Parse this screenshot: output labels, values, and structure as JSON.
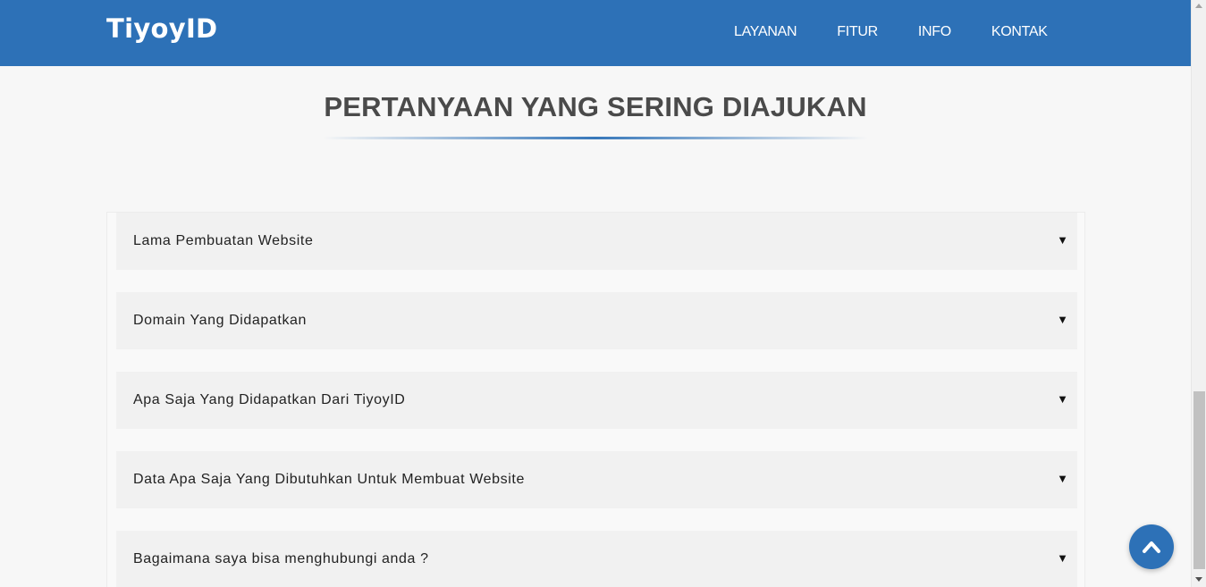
{
  "header": {
    "brand": "TiyoyID",
    "nav": [
      "LAYANAN",
      "FITUR",
      "INFO",
      "KONTAK"
    ],
    "bg_color": "#2d71b7"
  },
  "faq_section": {
    "title": "PERTANYAAN YANG SERING DIAJUKAN",
    "items": [
      {
        "question": "Lama Pembuatan Website",
        "arrow": "▼"
      },
      {
        "question": "Domain Yang Didapatkan",
        "arrow": "▼"
      },
      {
        "question": "Apa Saja Yang Didapatkan Dari TiyoyID",
        "arrow": "▼"
      },
      {
        "question": "Data Apa Saja Yang Dibutuhkan Untuk Membuat Website",
        "arrow": "▼"
      },
      {
        "question": "Bagaimana saya bisa menghubungi anda ?",
        "arrow": "▼"
      }
    ]
  },
  "back_to_top": {
    "icon": "chevron-up-icon"
  },
  "scrollbar": {
    "position_fraction": 0.67
  }
}
